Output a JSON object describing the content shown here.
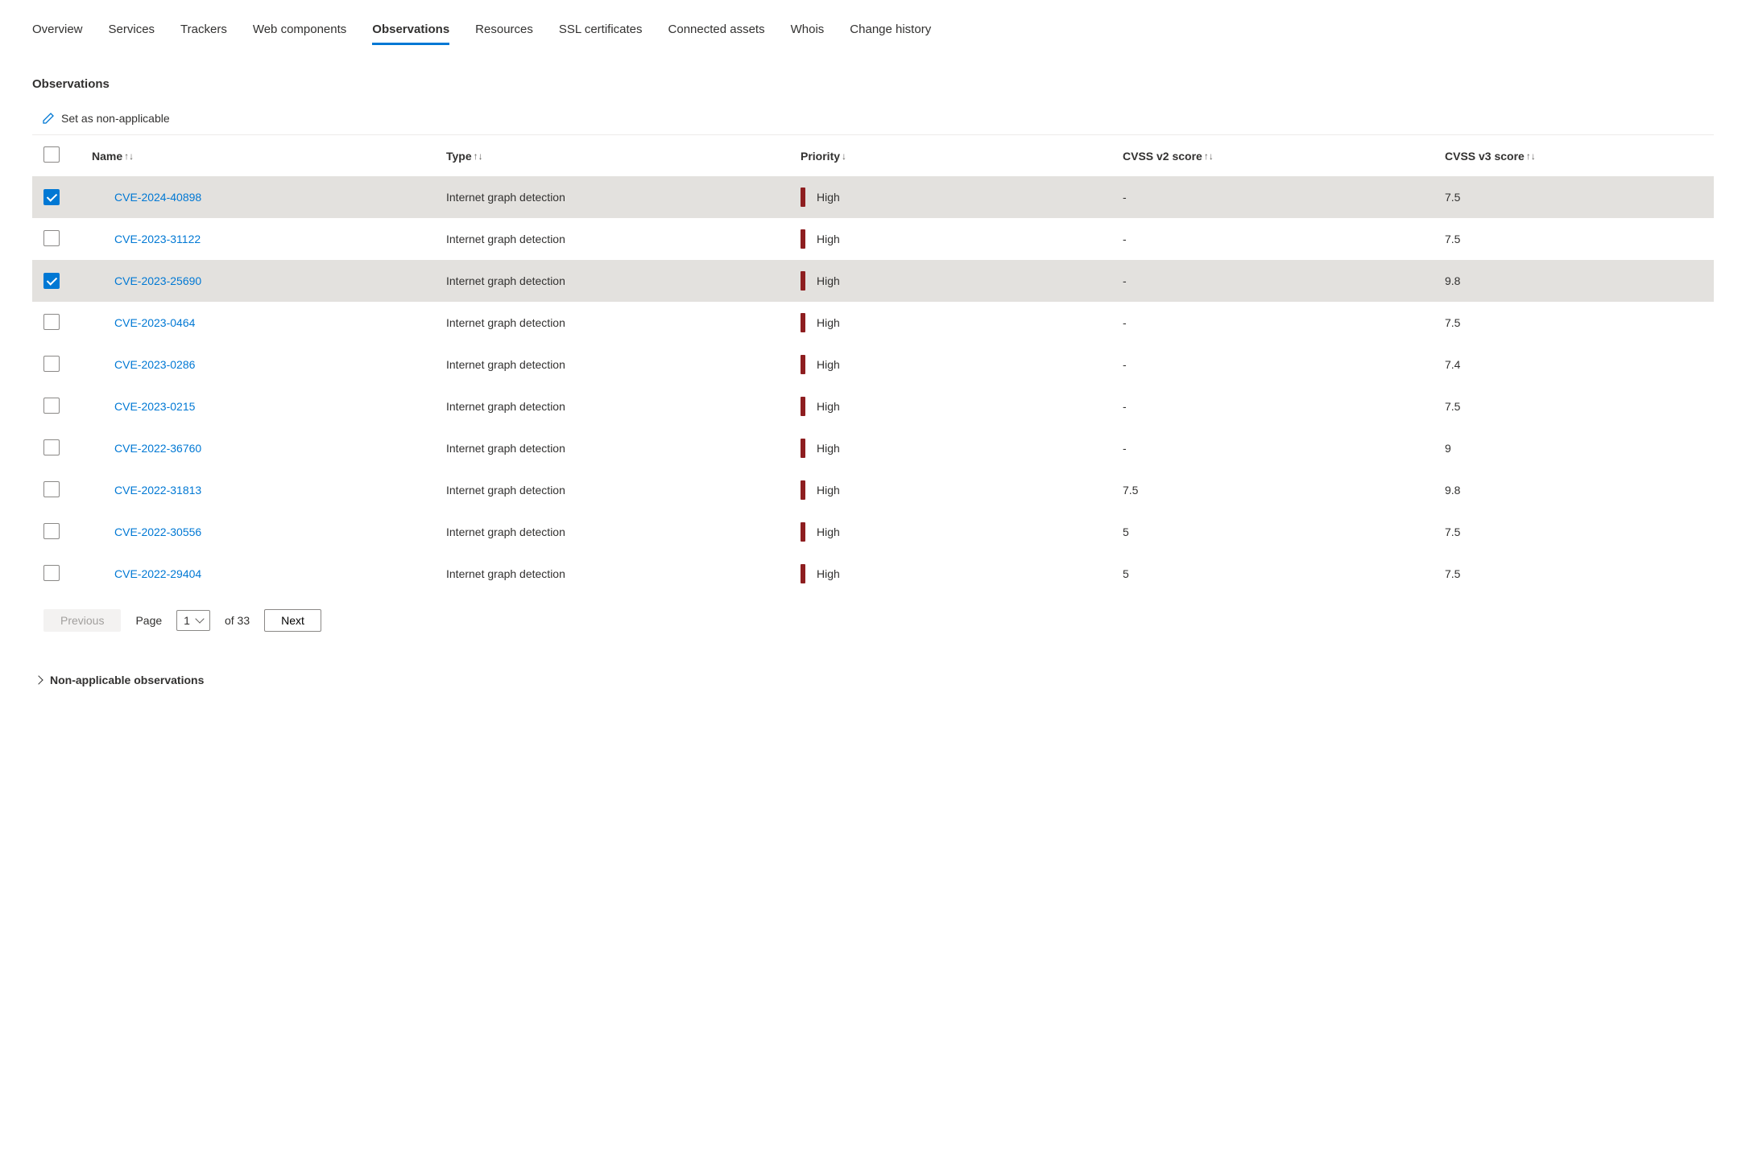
{
  "tabs": [
    "Overview",
    "Services",
    "Trackers",
    "Web components",
    "Observations",
    "Resources",
    "SSL certificates",
    "Connected assets",
    "Whois",
    "Change history"
  ],
  "activeTab": "Observations",
  "section": {
    "title": "Observations",
    "action": "Set as non-applicable"
  },
  "columns": {
    "name": "Name",
    "type": "Type",
    "priority": "Priority",
    "cvss2": "CVSS v2 score",
    "cvss3": "CVSS v3 score"
  },
  "rows": [
    {
      "selected": true,
      "name": "CVE-2024-40898",
      "type": "Internet graph detection",
      "priority": "High",
      "cvss2": "-",
      "cvss3": "7.5"
    },
    {
      "selected": false,
      "name": "CVE-2023-31122",
      "type": "Internet graph detection",
      "priority": "High",
      "cvss2": "-",
      "cvss3": "7.5"
    },
    {
      "selected": true,
      "name": "CVE-2023-25690",
      "type": "Internet graph detection",
      "priority": "High",
      "cvss2": "-",
      "cvss3": "9.8"
    },
    {
      "selected": false,
      "name": "CVE-2023-0464",
      "type": "Internet graph detection",
      "priority": "High",
      "cvss2": "-",
      "cvss3": "7.5"
    },
    {
      "selected": false,
      "name": "CVE-2023-0286",
      "type": "Internet graph detection",
      "priority": "High",
      "cvss2": "-",
      "cvss3": "7.4"
    },
    {
      "selected": false,
      "name": "CVE-2023-0215",
      "type": "Internet graph detection",
      "priority": "High",
      "cvss2": "-",
      "cvss3": "7.5"
    },
    {
      "selected": false,
      "name": "CVE-2022-36760",
      "type": "Internet graph detection",
      "priority": "High",
      "cvss2": "-",
      "cvss3": "9"
    },
    {
      "selected": false,
      "name": "CVE-2022-31813",
      "type": "Internet graph detection",
      "priority": "High",
      "cvss2": "7.5",
      "cvss3": "9.8"
    },
    {
      "selected": false,
      "name": "CVE-2022-30556",
      "type": "Internet graph detection",
      "priority": "High",
      "cvss2": "5",
      "cvss3": "7.5"
    },
    {
      "selected": false,
      "name": "CVE-2022-29404",
      "type": "Internet graph detection",
      "priority": "High",
      "cvss2": "5",
      "cvss3": "7.5"
    }
  ],
  "pagination": {
    "previous": "Previous",
    "next": "Next",
    "pageLabel": "Page",
    "current": "1",
    "of": "of 33"
  },
  "collapsible": {
    "nonApplicable": "Non-applicable observations"
  }
}
